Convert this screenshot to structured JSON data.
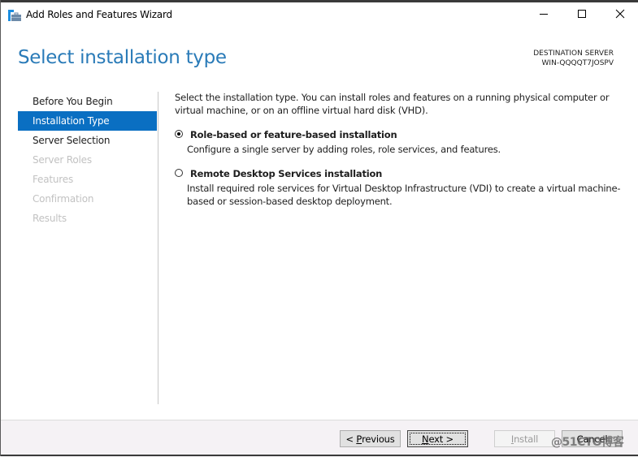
{
  "window": {
    "title": "Add Roles and Features Wizard",
    "app_icon": "server-manager-icon",
    "controls": {
      "minimize": "minimize-icon",
      "maximize": "maximize-icon",
      "close": "close-icon"
    }
  },
  "header": {
    "page_title": "Select installation type",
    "destination_label": "DESTINATION SERVER",
    "destination_server": "WIN-QQQQT7JOSPV"
  },
  "nav": {
    "items": [
      {
        "label": "Before You Begin",
        "state": "enabled"
      },
      {
        "label": "Installation Type",
        "state": "active"
      },
      {
        "label": "Server Selection",
        "state": "enabled"
      },
      {
        "label": "Server Roles",
        "state": "disabled"
      },
      {
        "label": "Features",
        "state": "disabled"
      },
      {
        "label": "Confirmation",
        "state": "disabled"
      },
      {
        "label": "Results",
        "state": "disabled"
      }
    ]
  },
  "content": {
    "intro": "Select the installation type. You can install roles and features on a running physical computer or virtual machine, or on an offline virtual hard disk (VHD).",
    "options": [
      {
        "label": "Role-based or feature-based installation",
        "description": "Configure a single server by adding roles, role services, and features.",
        "selected": true
      },
      {
        "label": "Remote Desktop Services installation",
        "description": "Install required role services for Virtual Desktop Infrastructure (VDI) to create a virtual machine-based or session-based desktop deployment.",
        "selected": false
      }
    ]
  },
  "footer": {
    "previous": {
      "prefix": "< ",
      "accel": "P",
      "rest": "revious"
    },
    "next": {
      "accel": "N",
      "rest": "ext >"
    },
    "install": {
      "accel": "I",
      "rest": "nstall",
      "enabled": false
    },
    "cancel": {
      "label": "Cancel"
    }
  },
  "watermark": "@51CTO博客"
}
